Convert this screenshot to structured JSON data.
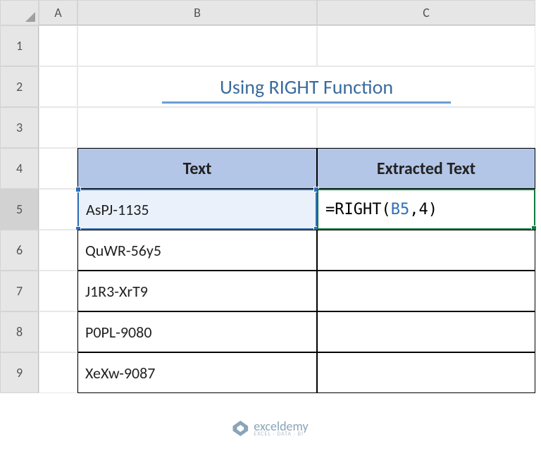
{
  "columns": [
    "A",
    "B",
    "C"
  ],
  "rows": [
    "1",
    "2",
    "3",
    "4",
    "5",
    "6",
    "7",
    "8",
    "9"
  ],
  "title": "Using RIGHT Function",
  "headers": {
    "text": "Text",
    "extracted": "Extracted Text"
  },
  "data": {
    "b5": "AsPJ-1135",
    "b6": "QuWR-56y5",
    "b7": "J1R3-XrT9",
    "b8": "P0PL-9080",
    "b9": "XeXw-9087"
  },
  "formula": {
    "prefix": "=RIGHT(",
    "ref": "B5",
    "suffix": ",4)"
  },
  "watermark": {
    "name": "exceldemy",
    "tag": "EXCEL · DATA · BI"
  },
  "chart_data": {
    "type": "table",
    "title": "Using RIGHT Function",
    "columns": [
      "Text",
      "Extracted Text"
    ],
    "rows": [
      [
        "AsPJ-1135",
        "=RIGHT(B5,4)"
      ],
      [
        "QuWR-56y5",
        ""
      ],
      [
        "J1R3-XrT9",
        ""
      ],
      [
        "P0PL-9080",
        ""
      ],
      [
        "XeXw-9087",
        ""
      ]
    ]
  }
}
